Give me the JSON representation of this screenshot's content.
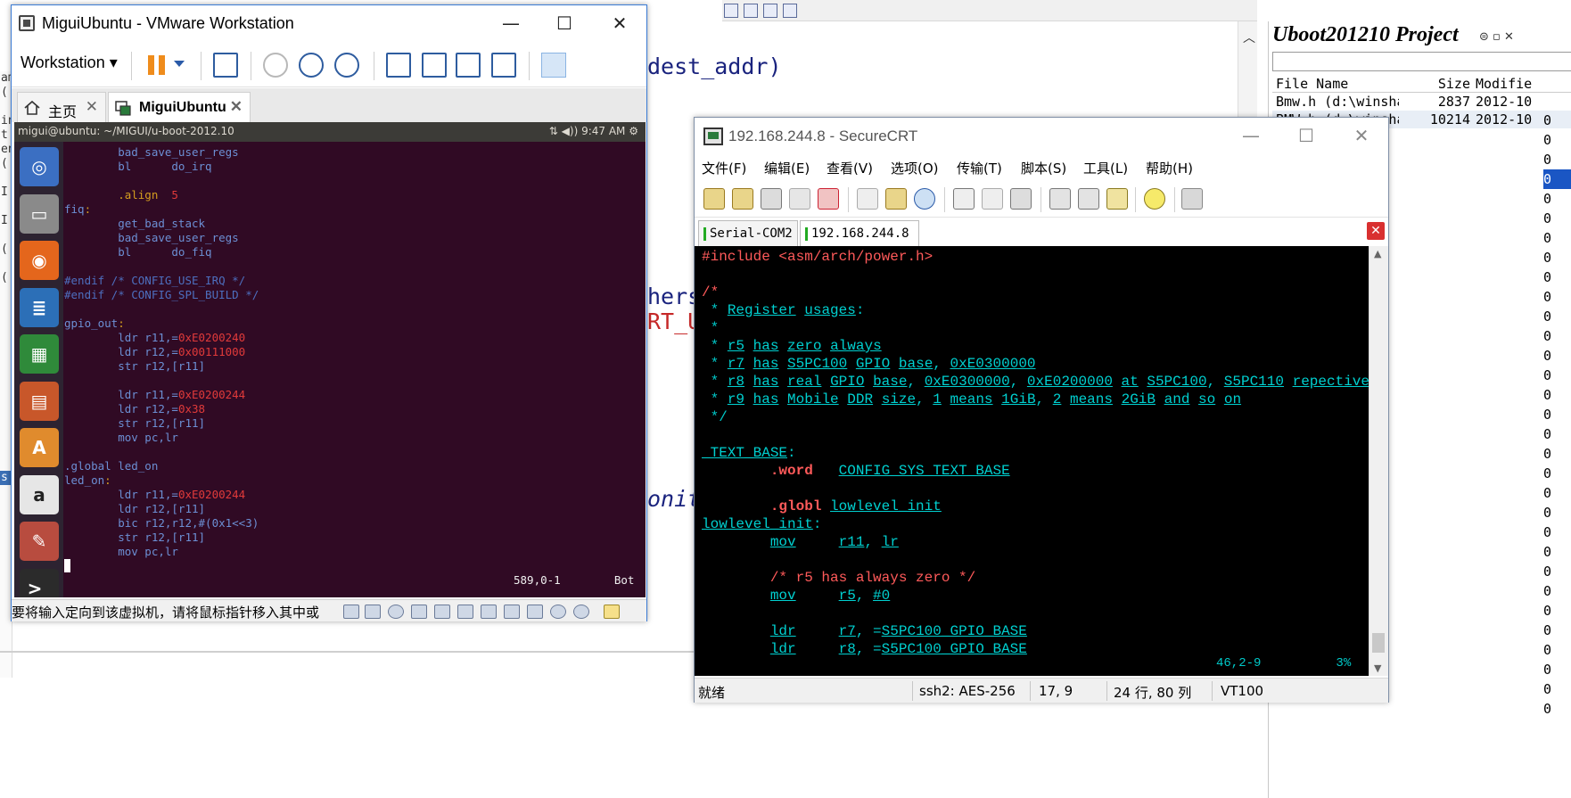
{
  "background_editor": {
    "code_fragments": [
      "dest_addr)",
      "hers",
      "RT_UB",
      "onito"
    ],
    "left_strip": [
      "am",
      "(",
      "",
      "in",
      "t",
      "en",
      "(",
      "",
      "I",
      "",
      "I",
      "",
      "(",
      "",
      "(",
      "",
      "",
      "",
      "",
      "",
      "",
      "",
      "",
      "",
      "",
      "",
      "",
      "",
      "s",
      "",
      "",
      "",
      "",
      "",
      "",
      "",
      "",
      "",
      "",
      ""
    ],
    "project_panel": {
      "title": "Uboot201210 Project",
      "columns": [
        "File Name",
        "Size",
        "Modifie"
      ],
      "rows": [
        {
          "name": "Bmw.h (d:\\winsha",
          "size": "2837",
          "modified": "2012-10"
        },
        {
          "name": "BMW.h (d:\\winsha",
          "size": "10214",
          "modified": "2012-10"
        }
      ],
      "sidebar_values": [
        "0",
        "0",
        "0",
        "0",
        "0",
        "0",
        "0",
        "0",
        "0",
        "0",
        "0",
        "0",
        "0",
        "0",
        "0",
        "0",
        "0",
        "0",
        "0",
        "0",
        "0",
        "0",
        "0",
        "0",
        "0",
        "0",
        "0",
        "0",
        "0",
        "0",
        "0"
      ]
    }
  },
  "vmware": {
    "title": "MiguiUbuntu - VMware Workstation",
    "controls": {
      "minimize": "—",
      "maximize": "☐",
      "close": "✕"
    },
    "menu_button": "Workstation ▾",
    "tabs": [
      {
        "label": "主页"
      },
      {
        "label": "MiguiUbuntu"
      }
    ],
    "tab_close": "✕",
    "ubuntu_panel": {
      "path": "migui@ubuntu: ~/MIGUI/u-boot-2012.10",
      "time": "9:47 AM",
      "indicators": "⇅  ◀)) "
    },
    "launcher": [
      {
        "name": "ubuntu-dash",
        "glyph": "◎",
        "color": "#3b6fc2"
      },
      {
        "name": "files",
        "glyph": "▭",
        "color": "#8a8a8a"
      },
      {
        "name": "firefox",
        "glyph": "◉",
        "color": "#e4661c"
      },
      {
        "name": "writer",
        "glyph": "≣",
        "color": "#2c6fb7"
      },
      {
        "name": "calc",
        "glyph": "▦",
        "color": "#2f8a3a"
      },
      {
        "name": "impress",
        "glyph": "▤",
        "color": "#c8572a"
      },
      {
        "name": "software-center",
        "glyph": "A",
        "color": "#e08b2d"
      },
      {
        "name": "amazon",
        "glyph": "a",
        "color": "#e6e6e6"
      },
      {
        "name": "system-settings",
        "glyph": "✎",
        "color": "#b84c3f"
      },
      {
        "name": "terminal",
        "glyph": ">_",
        "color": "#2b2b2b"
      }
    ],
    "terminal": {
      "lines": [
        [
          {
            "t": "        bad_save_user_regs",
            "k": "n"
          }
        ],
        [
          {
            "t": "        bl      do_irq",
            "k": "n"
          }
        ],
        [
          {
            "t": "",
            "k": "n"
          }
        ],
        [
          {
            "t": "        .align  ",
            "k": "y"
          },
          {
            "t": "5",
            "k": "r"
          }
        ],
        [
          {
            "t": "fiq",
            "k": "n"
          },
          {
            "t": ":",
            "k": "y"
          }
        ],
        [
          {
            "t": "        get_bad_stack",
            "k": "n"
          }
        ],
        [
          {
            "t": "        bad_save_user_regs",
            "k": "n"
          }
        ],
        [
          {
            "t": "        bl      do_fiq",
            "k": "n"
          }
        ],
        [
          {
            "t": "",
            "k": "n"
          }
        ],
        [
          {
            "t": "#endif /* CONFIG_USE_IRQ */",
            "k": "c"
          }
        ],
        [
          {
            "t": "#endif /* CONFIG_SPL_BUILD */",
            "k": "c"
          }
        ],
        [
          {
            "t": "",
            "k": "n"
          }
        ],
        [
          {
            "t": "gpio_out",
            "k": "n"
          },
          {
            "t": ":",
            "k": "y"
          }
        ],
        [
          {
            "t": "        ldr r11,=",
            "k": "n"
          },
          {
            "t": "0xE0200240",
            "k": "r"
          }
        ],
        [
          {
            "t": "        ldr r12,=",
            "k": "n"
          },
          {
            "t": "0x00111000",
            "k": "r"
          }
        ],
        [
          {
            "t": "        str r12,[r11]",
            "k": "n"
          }
        ],
        [
          {
            "t": "",
            "k": "n"
          }
        ],
        [
          {
            "t": "        ldr r11,=",
            "k": "n"
          },
          {
            "t": "0xE0200244",
            "k": "r"
          }
        ],
        [
          {
            "t": "        ldr r12,=",
            "k": "n"
          },
          {
            "t": "0x38",
            "k": "r"
          }
        ],
        [
          {
            "t": "        str r12,[r11]",
            "k": "n"
          }
        ],
        [
          {
            "t": "        mov pc,lr",
            "k": "n"
          }
        ],
        [
          {
            "t": "",
            "k": "n"
          }
        ],
        [
          {
            "t": ".global led_on",
            "k": "n"
          }
        ],
        [
          {
            "t": "led_on",
            "k": "n"
          },
          {
            "t": ":",
            "k": "y"
          }
        ],
        [
          {
            "t": "        ldr r11,=",
            "k": "n"
          },
          {
            "t": "0xE0200244",
            "k": "r"
          }
        ],
        [
          {
            "t": "        ldr r12,[r11]",
            "k": "n"
          }
        ],
        [
          {
            "t": "        bic r12,r12,#(0x1<<3)",
            "k": "n"
          }
        ],
        [
          {
            "t": "        str r12,[r11]",
            "k": "n"
          }
        ],
        [
          {
            "t": "        mov pc,lr",
            "k": "n"
          }
        ]
      ],
      "status": "589,0-1        Bot"
    },
    "statusbar_text": "要将输入定向到该虚拟机，请将鼠标指针移入其中或"
  },
  "securecrt": {
    "title": "192.168.244.8 - SecureCRT",
    "controls": {
      "minimize": "—",
      "maximize": "☐",
      "close": "✕"
    },
    "menu": [
      "文件(F)",
      "编辑(E)",
      "查看(V)",
      "选项(O)",
      "传输(T)",
      "脚本(S)",
      "工具(L)",
      "帮助(H)"
    ],
    "tabs": [
      "Serial-COM2",
      "192.168.244.8"
    ],
    "tab_close": "✕",
    "terminal": {
      "lines": [
        [
          {
            "t": "#include <asm/arch/power.h>",
            "k": "s"
          }
        ],
        [
          {
            "t": "",
            "k": "n"
          }
        ],
        [
          {
            "t": "/*",
            "k": "s"
          }
        ],
        [
          {
            "t": " * ",
            "k": "n"
          },
          {
            "t": "Register",
            "k": "u"
          },
          {
            "t": " ",
            "k": "n"
          },
          {
            "t": "usages",
            "k": "u"
          },
          {
            "t": ":",
            "k": "n"
          }
        ],
        [
          {
            "t": " *",
            "k": "n"
          }
        ],
        [
          {
            "t": " * ",
            "k": "n"
          },
          {
            "t": "r5",
            "k": "u"
          },
          {
            "t": " ",
            "k": "n"
          },
          {
            "t": "has",
            "k": "u"
          },
          {
            "t": " ",
            "k": "n"
          },
          {
            "t": "zero",
            "k": "u"
          },
          {
            "t": " ",
            "k": "n"
          },
          {
            "t": "always",
            "k": "u"
          }
        ],
        [
          {
            "t": " * ",
            "k": "n"
          },
          {
            "t": "r7",
            "k": "u"
          },
          {
            "t": " ",
            "k": "n"
          },
          {
            "t": "has",
            "k": "u"
          },
          {
            "t": " ",
            "k": "n"
          },
          {
            "t": "S5PC100",
            "k": "u"
          },
          {
            "t": " ",
            "k": "n"
          },
          {
            "t": "GPIO",
            "k": "u"
          },
          {
            "t": " ",
            "k": "n"
          },
          {
            "t": "base",
            "k": "u"
          },
          {
            "t": ", ",
            "k": "n"
          },
          {
            "t": "0xE0300000",
            "k": "u"
          }
        ],
        [
          {
            "t": " * ",
            "k": "n"
          },
          {
            "t": "r8",
            "k": "u"
          },
          {
            "t": " ",
            "k": "n"
          },
          {
            "t": "has",
            "k": "u"
          },
          {
            "t": " ",
            "k": "n"
          },
          {
            "t": "real",
            "k": "u"
          },
          {
            "t": " ",
            "k": "n"
          },
          {
            "t": "GPIO",
            "k": "u"
          },
          {
            "t": " ",
            "k": "n"
          },
          {
            "t": "base",
            "k": "u"
          },
          {
            "t": ", ",
            "k": "n"
          },
          {
            "t": "0xE0300000",
            "k": "u"
          },
          {
            "t": ", ",
            "k": "n"
          },
          {
            "t": "0xE0200000",
            "k": "u"
          },
          {
            "t": " ",
            "k": "n"
          },
          {
            "t": "at",
            "k": "u"
          },
          {
            "t": " ",
            "k": "n"
          },
          {
            "t": "S5PC100",
            "k": "u"
          },
          {
            "t": ", ",
            "k": "n"
          },
          {
            "t": "S5PC110",
            "k": "u"
          },
          {
            "t": " ",
            "k": "n"
          },
          {
            "t": "repectively",
            "k": "u"
          }
        ],
        [
          {
            "t": " * ",
            "k": "n"
          },
          {
            "t": "r9",
            "k": "u"
          },
          {
            "t": " ",
            "k": "n"
          },
          {
            "t": "has",
            "k": "u"
          },
          {
            "t": " ",
            "k": "n"
          },
          {
            "t": "Mobile",
            "k": "u"
          },
          {
            "t": " ",
            "k": "n"
          },
          {
            "t": "DDR",
            "k": "u"
          },
          {
            "t": " ",
            "k": "n"
          },
          {
            "t": "size",
            "k": "u"
          },
          {
            "t": ", ",
            "k": "n"
          },
          {
            "t": "1",
            "k": "u"
          },
          {
            "t": " ",
            "k": "n"
          },
          {
            "t": "means",
            "k": "u"
          },
          {
            "t": " ",
            "k": "n"
          },
          {
            "t": "1GiB",
            "k": "u"
          },
          {
            "t": ", ",
            "k": "n"
          },
          {
            "t": "2",
            "k": "u"
          },
          {
            "t": " ",
            "k": "n"
          },
          {
            "t": "means",
            "k": "u"
          },
          {
            "t": " ",
            "k": "n"
          },
          {
            "t": "2GiB",
            "k": "u"
          },
          {
            "t": " ",
            "k": "n"
          },
          {
            "t": "and",
            "k": "u"
          },
          {
            "t": " ",
            "k": "n"
          },
          {
            "t": "so",
            "k": "u"
          },
          {
            "t": " ",
            "k": "n"
          },
          {
            "t": "on",
            "k": "u"
          }
        ],
        [
          {
            "t": " */",
            "k": "n"
          }
        ],
        [
          {
            "t": "",
            "k": "n"
          }
        ],
        [
          {
            "t": "_TEXT_BASE",
            "k": "u"
          },
          {
            "t": ":",
            "k": "n"
          }
        ],
        [
          {
            "t": "        ",
            "k": "n"
          },
          {
            "t": ".word",
            "k": "sb"
          },
          {
            "t": "   ",
            "k": "n"
          },
          {
            "t": "CONFIG_SYS_TEXT_BASE",
            "k": "u"
          }
        ],
        [
          {
            "t": "",
            "k": "n"
          }
        ],
        [
          {
            "t": "        ",
            "k": "n"
          },
          {
            "t": ".globl",
            "k": "sb"
          },
          {
            "t": " ",
            "k": "n"
          },
          {
            "t": "lowlevel_init",
            "k": "u"
          }
        ],
        [
          {
            "t": "lowlevel_init",
            "k": "u"
          },
          {
            "t": ":",
            "k": "n"
          }
        ],
        [
          {
            "t": "        ",
            "k": "n"
          },
          {
            "t": "mov",
            "k": "u"
          },
          {
            "t": "     ",
            "k": "n"
          },
          {
            "t": "r11",
            "k": "u"
          },
          {
            "t": ", ",
            "k": "n"
          },
          {
            "t": "lr",
            "k": "u"
          }
        ],
        [
          {
            "t": "",
            "k": "n"
          }
        ],
        [
          {
            "t": "        /* r5 has always zero */",
            "k": "s"
          }
        ],
        [
          {
            "t": "        ",
            "k": "n"
          },
          {
            "t": "mov",
            "k": "u"
          },
          {
            "t": "     ",
            "k": "n"
          },
          {
            "t": "r5",
            "k": "u"
          },
          {
            "t": ", ",
            "k": "n"
          },
          {
            "t": "#0",
            "k": "u"
          }
        ],
        [
          {
            "t": "",
            "k": "n"
          }
        ],
        [
          {
            "t": "        ",
            "k": "n"
          },
          {
            "t": "ldr",
            "k": "u"
          },
          {
            "t": "     ",
            "k": "n"
          },
          {
            "t": "r7",
            "k": "u"
          },
          {
            "t": ", =",
            "k": "n"
          },
          {
            "t": "S5PC100_GPIO_BASE",
            "k": "u"
          }
        ],
        [
          {
            "t": "        ",
            "k": "n"
          },
          {
            "t": "ldr",
            "k": "u"
          },
          {
            "t": "     ",
            "k": "n"
          },
          {
            "t": "r8",
            "k": "u"
          },
          {
            "t": ", =",
            "k": "n"
          },
          {
            "t": "S5PC100_GPIO_BASE",
            "k": "u"
          }
        ]
      ],
      "status": "46,2-9          3%"
    },
    "statusbar": {
      "ready": "就绪",
      "protocol": "ssh2: AES-256",
      "position": "17,   9",
      "size": "24 行, 80 列",
      "emulation": "VT100"
    }
  },
  "colors": {
    "ubuntu_terminal_bg": "#300a24",
    "securecrt_terminal_bg": "#000000",
    "terminal_cyan": "#00c8c8",
    "terminal_red": "#ff5a5a",
    "vmware_pause": "#ef8c1c"
  }
}
